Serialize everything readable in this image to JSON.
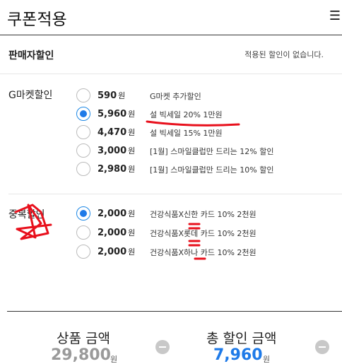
{
  "header": {
    "title": "쿠폰적용",
    "menu_glyph": "☰"
  },
  "seller": {
    "title": "판매자할인",
    "message": "적용된 할인이 없습니다."
  },
  "gmarket": {
    "title": "G마켓할인",
    "options": [
      {
        "amount": "590",
        "unit": "원",
        "desc": "G마켓 추가할인",
        "selected": false
      },
      {
        "amount": "5,960",
        "unit": "원",
        "desc": "설 빅세일 20% 1만원",
        "selected": true
      },
      {
        "amount": "4,470",
        "unit": "원",
        "desc": "설 빅세일 15% 1만원",
        "selected": false
      },
      {
        "amount": "3,000",
        "unit": "원",
        "desc": "[1월] 스마일클럽만 드리는 12% 할인",
        "selected": false
      },
      {
        "amount": "2,980",
        "unit": "원",
        "desc": "[1월] 스마일클럽만 드리는 10% 할인",
        "selected": false
      }
    ]
  },
  "duplicate": {
    "title": "중복할인",
    "options": [
      {
        "amount": "2,000",
        "unit": "원",
        "desc": "건강식품X신한 카드 10% 2천원",
        "selected": true
      },
      {
        "amount": "2,000",
        "unit": "원",
        "desc": "건강식품X롯데 카드 10% 2천원",
        "selected": false
      },
      {
        "amount": "2,000",
        "unit": "원",
        "desc": "건강식품X하나 카드 10% 2천원",
        "selected": false
      }
    ]
  },
  "summary": {
    "product_label": "상품 금액",
    "product_value": "29,800",
    "product_unit": "원",
    "discount_label": "총 할인 금액",
    "discount_value": "7,960",
    "discount_unit": "원"
  },
  "colors": {
    "accent": "#1e7ae8",
    "annotation": "#e8101c",
    "muted_value": "#9a9a9a"
  }
}
